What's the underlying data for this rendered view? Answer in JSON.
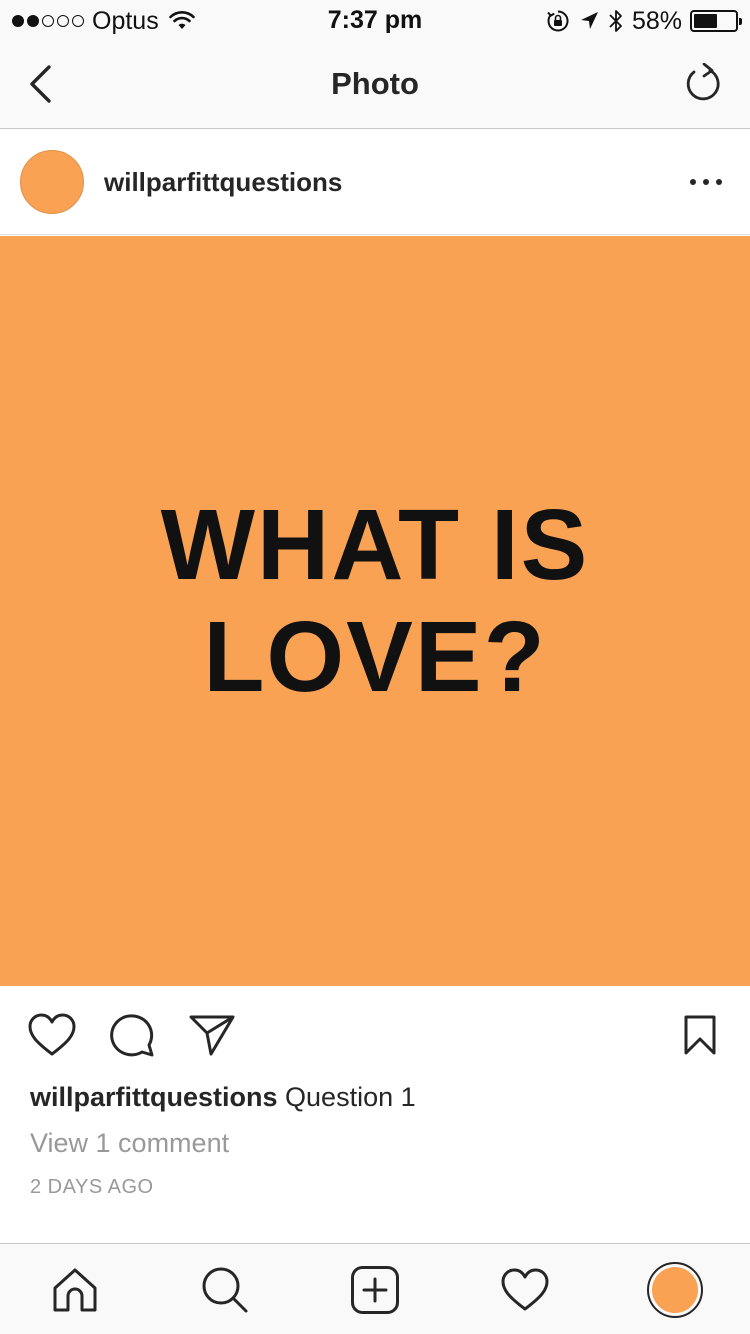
{
  "status_bar": {
    "carrier": "Optus",
    "signal_filled": 2,
    "signal_total": 5,
    "time": "7:37 pm",
    "battery_percent_label": "58%",
    "battery_level": 0.58,
    "icons": [
      "wifi-icon",
      "orientation-lock-icon",
      "location-arrow-icon",
      "bluetooth-icon",
      "battery-icon"
    ]
  },
  "nav": {
    "title": "Photo",
    "back_icon": "chevron-left-icon",
    "refresh_icon": "refresh-icon"
  },
  "post": {
    "username": "willparfittquestions",
    "avatar_color": "#f9a253",
    "image": {
      "background": "#f9a253",
      "text_line1": "WHAT IS",
      "text_line2": "LOVE?"
    },
    "caption_username": "willparfittquestions",
    "caption_text": "Question 1",
    "view_comments": "View 1 comment",
    "timestamp": "2 DAYS AGO"
  },
  "actions": [
    "heart-icon",
    "comment-icon",
    "share-icon",
    "bookmark-icon"
  ],
  "tab_bar": [
    "home-icon",
    "search-icon",
    "add-icon",
    "heart-icon",
    "profile-avatar"
  ]
}
